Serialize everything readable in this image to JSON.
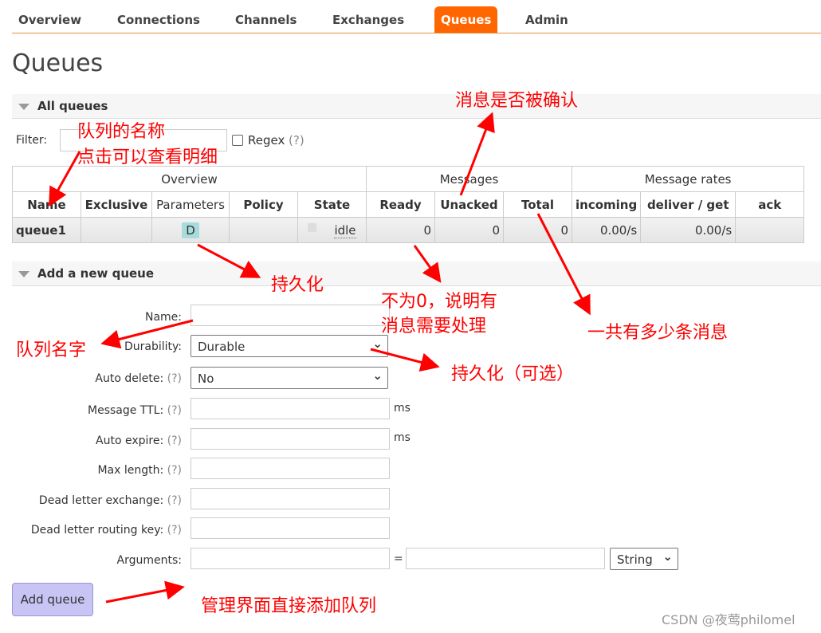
{
  "nav": {
    "items": [
      "Overview",
      "Connections",
      "Channels",
      "Exchanges",
      "Queues",
      "Admin"
    ],
    "active": "Queues"
  },
  "page_title": "Queues",
  "all_queues": {
    "title": "All queues",
    "filter_label": "Filter:",
    "regex_label": "Regex",
    "help": "(?)"
  },
  "table": {
    "groups": [
      "Overview",
      "Messages",
      "Message rates"
    ],
    "headers": [
      "Name",
      "Exclusive",
      "Parameters",
      "Policy",
      "State",
      "Ready",
      "Unacked",
      "Total",
      "incoming",
      "deliver / get",
      "ack"
    ],
    "rows": [
      {
        "name": "queue1",
        "exclusive": "",
        "parameters": "D",
        "policy": "",
        "state": "idle",
        "ready": "0",
        "unacked": "0",
        "total": "0",
        "incoming": "0.00/s",
        "deliver_get": "0.00/s",
        "ack": ""
      }
    ]
  },
  "add_queue": {
    "title": "Add a new queue",
    "name_label": "Name:",
    "durability_label": "Durability:",
    "durability_value": "Durable",
    "auto_delete_label": "Auto delete:",
    "auto_delete_value": "No",
    "ttl_label": "Message TTL:",
    "auto_expire_label": "Auto expire:",
    "max_length_label": "Max length:",
    "dlx_label": "Dead letter exchange:",
    "dlrk_label": "Dead letter routing key:",
    "arguments_label": "Arguments:",
    "equals": "=",
    "arg_type": "String",
    "ms": "ms",
    "help": "(?)",
    "button": "Add queue"
  },
  "annotations": {
    "queue_name": "队列的名称",
    "click_detail": "点击可以查看明细",
    "acked": "消息是否被确认",
    "durable": "持久化",
    "not_zero_1": "不为0，说明有",
    "not_zero_2": "消息需要处理",
    "total": "一共有多少条消息",
    "name_field": "队列名字",
    "durable_optional": "持久化（可选）",
    "add_direct": "管理界面直接添加队列"
  },
  "watermark": "CSDN @夜莺philomel",
  "colors": {
    "accent": "#ff6600",
    "annotation": "#ff0000",
    "button": "#c8c4f4"
  }
}
